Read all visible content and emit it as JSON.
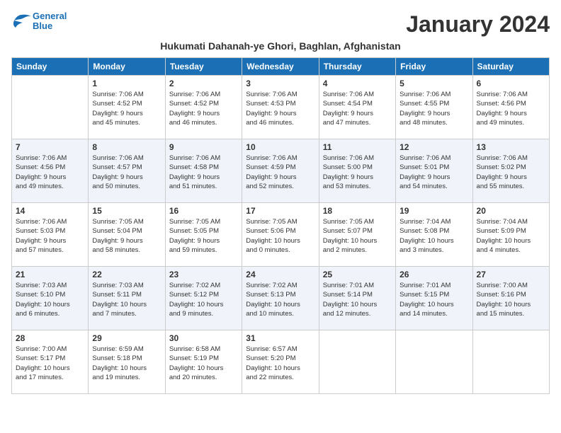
{
  "logo": {
    "line1": "General",
    "line2": "Blue"
  },
  "title": "January 2024",
  "subtitle": "Hukumati Dahanah-ye Ghori, Baghlan, Afghanistan",
  "weekdays": [
    "Sunday",
    "Monday",
    "Tuesday",
    "Wednesday",
    "Thursday",
    "Friday",
    "Saturday"
  ],
  "weeks": [
    [
      {
        "day": "",
        "info": ""
      },
      {
        "day": "1",
        "info": "Sunrise: 7:06 AM\nSunset: 4:52 PM\nDaylight: 9 hours\nand 45 minutes."
      },
      {
        "day": "2",
        "info": "Sunrise: 7:06 AM\nSunset: 4:52 PM\nDaylight: 9 hours\nand 46 minutes."
      },
      {
        "day": "3",
        "info": "Sunrise: 7:06 AM\nSunset: 4:53 PM\nDaylight: 9 hours\nand 46 minutes."
      },
      {
        "day": "4",
        "info": "Sunrise: 7:06 AM\nSunset: 4:54 PM\nDaylight: 9 hours\nand 47 minutes."
      },
      {
        "day": "5",
        "info": "Sunrise: 7:06 AM\nSunset: 4:55 PM\nDaylight: 9 hours\nand 48 minutes."
      },
      {
        "day": "6",
        "info": "Sunrise: 7:06 AM\nSunset: 4:56 PM\nDaylight: 9 hours\nand 49 minutes."
      }
    ],
    [
      {
        "day": "7",
        "info": "Sunrise: 7:06 AM\nSunset: 4:56 PM\nDaylight: 9 hours\nand 49 minutes."
      },
      {
        "day": "8",
        "info": "Sunrise: 7:06 AM\nSunset: 4:57 PM\nDaylight: 9 hours\nand 50 minutes."
      },
      {
        "day": "9",
        "info": "Sunrise: 7:06 AM\nSunset: 4:58 PM\nDaylight: 9 hours\nand 51 minutes."
      },
      {
        "day": "10",
        "info": "Sunrise: 7:06 AM\nSunset: 4:59 PM\nDaylight: 9 hours\nand 52 minutes."
      },
      {
        "day": "11",
        "info": "Sunrise: 7:06 AM\nSunset: 5:00 PM\nDaylight: 9 hours\nand 53 minutes."
      },
      {
        "day": "12",
        "info": "Sunrise: 7:06 AM\nSunset: 5:01 PM\nDaylight: 9 hours\nand 54 minutes."
      },
      {
        "day": "13",
        "info": "Sunrise: 7:06 AM\nSunset: 5:02 PM\nDaylight: 9 hours\nand 55 minutes."
      }
    ],
    [
      {
        "day": "14",
        "info": "Sunrise: 7:06 AM\nSunset: 5:03 PM\nDaylight: 9 hours\nand 57 minutes."
      },
      {
        "day": "15",
        "info": "Sunrise: 7:05 AM\nSunset: 5:04 PM\nDaylight: 9 hours\nand 58 minutes."
      },
      {
        "day": "16",
        "info": "Sunrise: 7:05 AM\nSunset: 5:05 PM\nDaylight: 9 hours\nand 59 minutes."
      },
      {
        "day": "17",
        "info": "Sunrise: 7:05 AM\nSunset: 5:06 PM\nDaylight: 10 hours\nand 0 minutes."
      },
      {
        "day": "18",
        "info": "Sunrise: 7:05 AM\nSunset: 5:07 PM\nDaylight: 10 hours\nand 2 minutes."
      },
      {
        "day": "19",
        "info": "Sunrise: 7:04 AM\nSunset: 5:08 PM\nDaylight: 10 hours\nand 3 minutes."
      },
      {
        "day": "20",
        "info": "Sunrise: 7:04 AM\nSunset: 5:09 PM\nDaylight: 10 hours\nand 4 minutes."
      }
    ],
    [
      {
        "day": "21",
        "info": "Sunrise: 7:03 AM\nSunset: 5:10 PM\nDaylight: 10 hours\nand 6 minutes."
      },
      {
        "day": "22",
        "info": "Sunrise: 7:03 AM\nSunset: 5:11 PM\nDaylight: 10 hours\nand 7 minutes."
      },
      {
        "day": "23",
        "info": "Sunrise: 7:02 AM\nSunset: 5:12 PM\nDaylight: 10 hours\nand 9 minutes."
      },
      {
        "day": "24",
        "info": "Sunrise: 7:02 AM\nSunset: 5:13 PM\nDaylight: 10 hours\nand 10 minutes."
      },
      {
        "day": "25",
        "info": "Sunrise: 7:01 AM\nSunset: 5:14 PM\nDaylight: 10 hours\nand 12 minutes."
      },
      {
        "day": "26",
        "info": "Sunrise: 7:01 AM\nSunset: 5:15 PM\nDaylight: 10 hours\nand 14 minutes."
      },
      {
        "day": "27",
        "info": "Sunrise: 7:00 AM\nSunset: 5:16 PM\nDaylight: 10 hours\nand 15 minutes."
      }
    ],
    [
      {
        "day": "28",
        "info": "Sunrise: 7:00 AM\nSunset: 5:17 PM\nDaylight: 10 hours\nand 17 minutes."
      },
      {
        "day": "29",
        "info": "Sunrise: 6:59 AM\nSunset: 5:18 PM\nDaylight: 10 hours\nand 19 minutes."
      },
      {
        "day": "30",
        "info": "Sunrise: 6:58 AM\nSunset: 5:19 PM\nDaylight: 10 hours\nand 20 minutes."
      },
      {
        "day": "31",
        "info": "Sunrise: 6:57 AM\nSunset: 5:20 PM\nDaylight: 10 hours\nand 22 minutes."
      },
      {
        "day": "",
        "info": ""
      },
      {
        "day": "",
        "info": ""
      },
      {
        "day": "",
        "info": ""
      }
    ]
  ]
}
